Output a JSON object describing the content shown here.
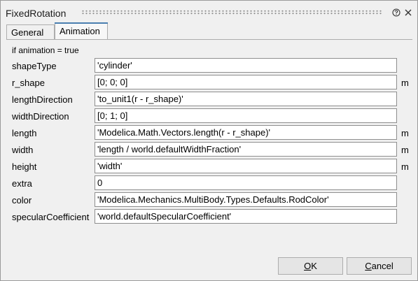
{
  "window": {
    "title": "FixedRotation"
  },
  "tabs": [
    {
      "label": "General",
      "active": false
    },
    {
      "label": "Animation",
      "active": true
    }
  ],
  "panel": {
    "condition": "if animation = true"
  },
  "params": [
    {
      "name": "shapeType",
      "value": "'cylinder'",
      "unit": ""
    },
    {
      "name": "r_shape",
      "value": "[0; 0; 0]",
      "unit": "m"
    },
    {
      "name": "lengthDirection",
      "value": "'to_unit1(r - r_shape)'",
      "unit": ""
    },
    {
      "name": "widthDirection",
      "value": "[0; 1; 0]",
      "unit": ""
    },
    {
      "name": "length",
      "value": "'Modelica.Math.Vectors.length(r - r_shape)'",
      "unit": "m"
    },
    {
      "name": "width",
      "value": "'length / world.defaultWidthFraction'",
      "unit": "m"
    },
    {
      "name": "height",
      "value": "'width'",
      "unit": "m"
    },
    {
      "name": "extra",
      "value": "0",
      "unit": ""
    },
    {
      "name": "color",
      "value": "'Modelica.Mechanics.MultiBody.Types.Defaults.RodColor'",
      "unit": ""
    },
    {
      "name": "specularCoefficient",
      "value": "'world.defaultSpecularCoefficient'",
      "unit": ""
    }
  ],
  "buttons": {
    "ok_mnemonic": "O",
    "ok_rest": "K",
    "cancel_mnemonic": "C",
    "cancel_rest": "ancel"
  },
  "icons": {
    "help": "help-icon",
    "close": "close-icon"
  },
  "colors": {
    "active_tab_accent": "#4a7fb0",
    "window_bg": "#f0f0f0",
    "field_bg": "#ffffff"
  }
}
